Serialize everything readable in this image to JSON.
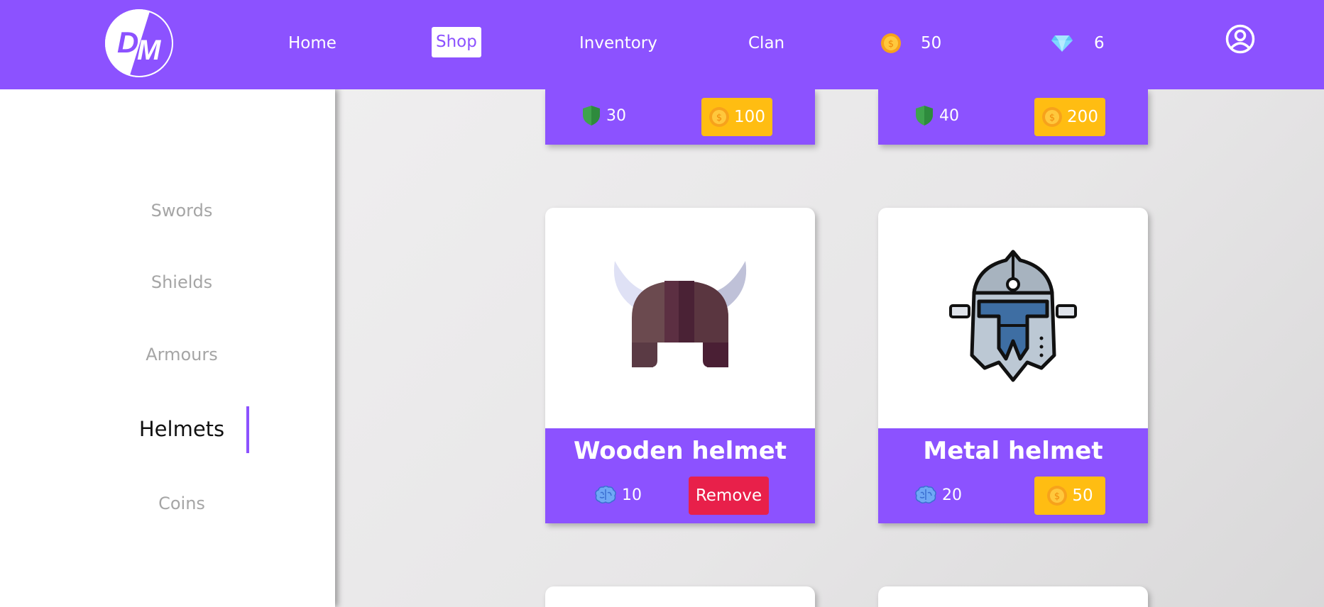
{
  "header": {
    "logo_text": "DM",
    "nav": [
      {
        "label": "Home"
      },
      {
        "label": "Shop",
        "active": true
      },
      {
        "label": "Inventory"
      },
      {
        "label": "Clan"
      }
    ],
    "coins": "50",
    "gems": "6"
  },
  "sidebar": {
    "items": [
      {
        "label": "Swords"
      },
      {
        "label": "Shields"
      },
      {
        "label": "Armours"
      },
      {
        "label": "Helmets",
        "active": true
      },
      {
        "label": "Coins"
      }
    ]
  },
  "cards_top": [
    {
      "stat": "30",
      "price": "100"
    },
    {
      "stat": "40",
      "price": "200"
    }
  ],
  "cards": [
    {
      "title": "Wooden helmet",
      "stat": "10",
      "action": "Remove"
    },
    {
      "title": "Metal helmet",
      "stat": "20",
      "price": "50"
    }
  ],
  "colors": {
    "accent": "#8c52ff",
    "price": "#ffbd12",
    "remove": "#e8204a"
  }
}
